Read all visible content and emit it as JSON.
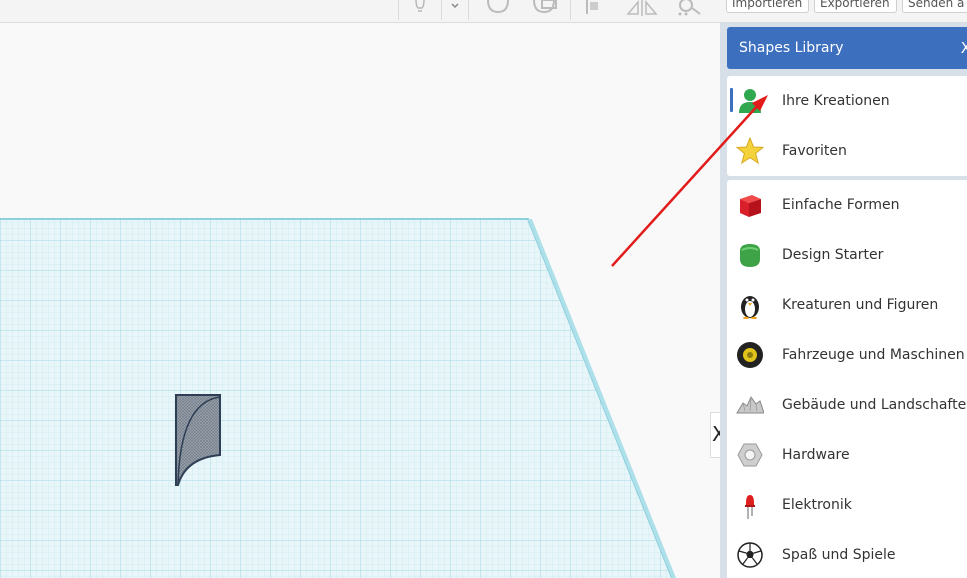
{
  "toolbar": {
    "icons": [
      "lightbulb-icon",
      "dropdown-icon",
      "rotate-icon",
      "duplicate-icon",
      "align-icon",
      "mirror-icon",
      "group-icon"
    ],
    "buttons": [
      {
        "label": "Importieren"
      },
      {
        "label": "Exportieren"
      },
      {
        "label": "Senden a"
      }
    ]
  },
  "panel": {
    "title": "Shapes Library",
    "close_label": "X",
    "my_items": [
      {
        "label": "Ihre Kreationen",
        "icon": "person-icon",
        "selected": true
      },
      {
        "label": "Favoriten",
        "icon": "star-icon",
        "selected": false
      }
    ],
    "categories": [
      {
        "label": "Einfache Formen",
        "icon": "red-cube-icon"
      },
      {
        "label": "Design Starter",
        "icon": "green-blob-icon"
      },
      {
        "label": "Kreaturen und Figuren",
        "icon": "penguin-icon"
      },
      {
        "label": "Fahrzeuge und Maschinen",
        "icon": "wheel-icon"
      },
      {
        "label": "Gebäude und Landschaften",
        "icon": "landscape-icon"
      },
      {
        "label": "Hardware",
        "icon": "nut-icon"
      },
      {
        "label": "Elektronik",
        "icon": "led-icon"
      },
      {
        "label": "Spaß und Spiele",
        "icon": "soccer-ball-icon"
      }
    ]
  },
  "panel_toggle": {
    "label": "X"
  },
  "colors": {
    "accent": "#3d6fbf",
    "annotation": "#e21b1b",
    "grid": "#9fd8e4"
  }
}
